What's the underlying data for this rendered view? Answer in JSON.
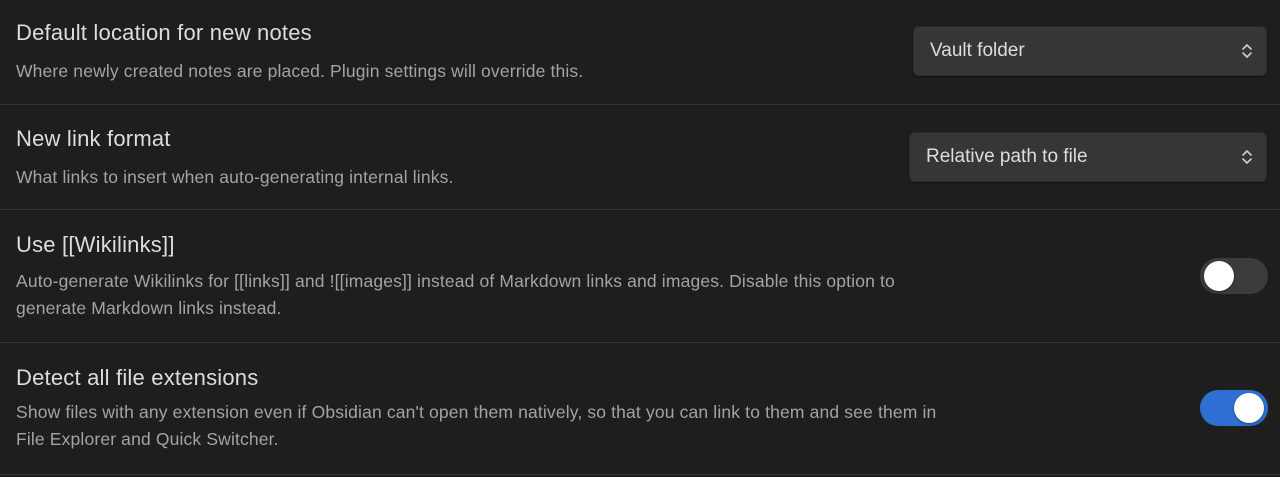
{
  "settings": [
    {
      "name": "Default location for new notes",
      "description": "Where newly created notes are placed. Plugin settings will override this.",
      "control": "dropdown",
      "value": "Vault folder"
    },
    {
      "name": "New link format",
      "description": "What links to insert when auto-generating internal links.",
      "control": "dropdown",
      "value": "Relative path to file"
    },
    {
      "name": "Use [[Wikilinks]]",
      "description_line1": "Auto-generate Wikilinks for [[links]] and ![[images]] instead of Markdown links and images. Disable this option to",
      "description_line2": "generate Markdown links instead.",
      "control": "toggle",
      "enabled": false
    },
    {
      "name": "Detect all file extensions",
      "description_line1": "Show files with any extension even if Obsidian can't open them natively, so that you can link to them and see them in",
      "description_line2": "File Explorer and Quick Switcher.",
      "control": "toggle",
      "enabled": true
    }
  ],
  "icons": {
    "dropdown": "chevron-up-down-icon"
  },
  "colors": {
    "background": "#1e1e1e",
    "toggle_on": "#2f6fd1",
    "toggle_off": "#3c3c3c"
  }
}
